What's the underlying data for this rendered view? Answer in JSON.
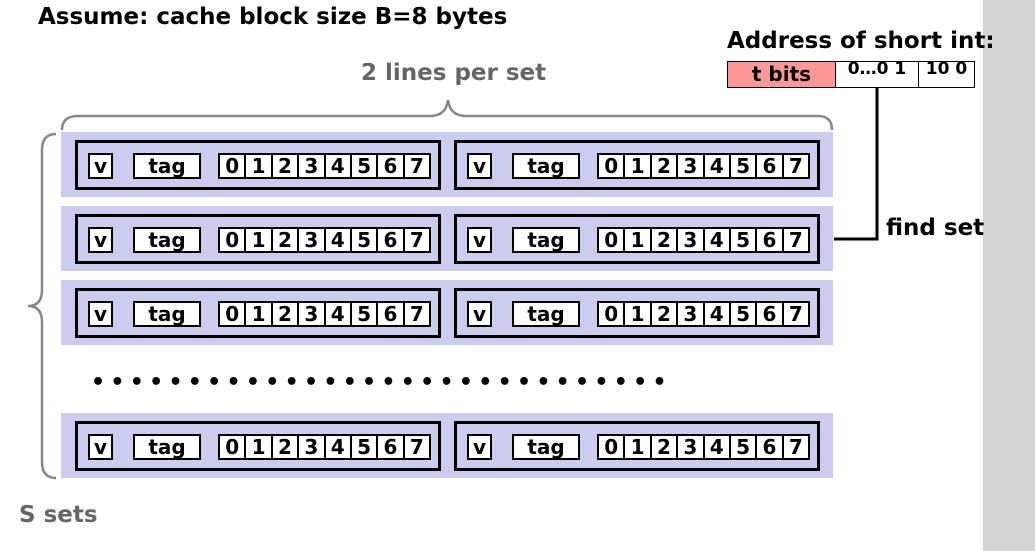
{
  "title": "Assume: cache block size B=8 bytes",
  "lines_per_set_label": "2 lines per set",
  "sets_label": "S sets",
  "address": {
    "title": "Address of short int:",
    "t_bits": "t bits",
    "set_bits": "0…0 1",
    "offset_bits": "10 0"
  },
  "find_set_label": "find set",
  "line_fields": {
    "valid": "v",
    "tag": "tag",
    "bytes": [
      "0",
      "1",
      "2",
      "3",
      "4",
      "5",
      "6",
      "7"
    ]
  },
  "ellipsis": "••••••••••••••••••••••••••••••",
  "colors": {
    "set_bg": "#ccccee",
    "t_bits_bg": "#ff9999",
    "label_gray": "#666666",
    "scroll_gray": "#d4d4d4"
  }
}
